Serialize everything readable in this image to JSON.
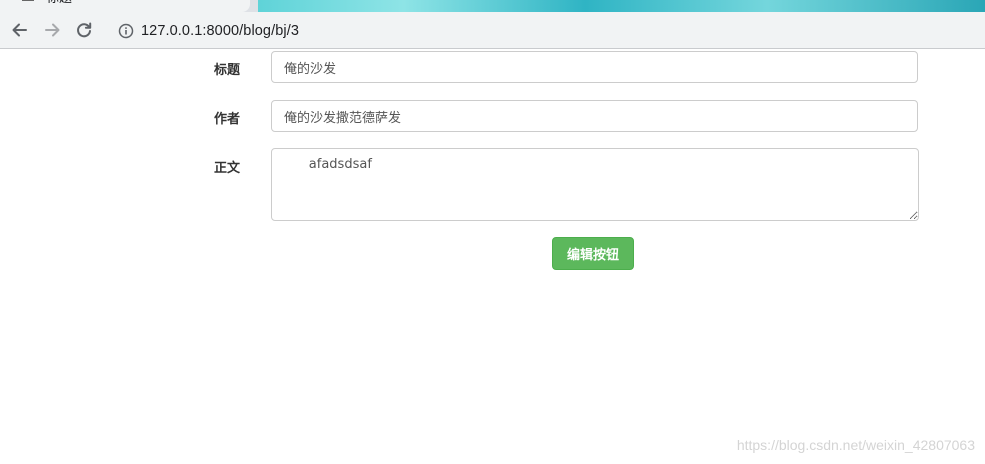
{
  "browser": {
    "tab_title": "标题",
    "url": "127.0.0.1:8000/blog/bj/3"
  },
  "form": {
    "title_label": "标题",
    "title_value": "俺的沙发",
    "author_label": "作者",
    "author_value": "俺的沙发撒范德萨发",
    "body_label": "正文",
    "body_value": "      afadsdsaf",
    "submit_label": "编辑按钮"
  },
  "watermark": "https://blog.csdn.net/weixin_42807063"
}
